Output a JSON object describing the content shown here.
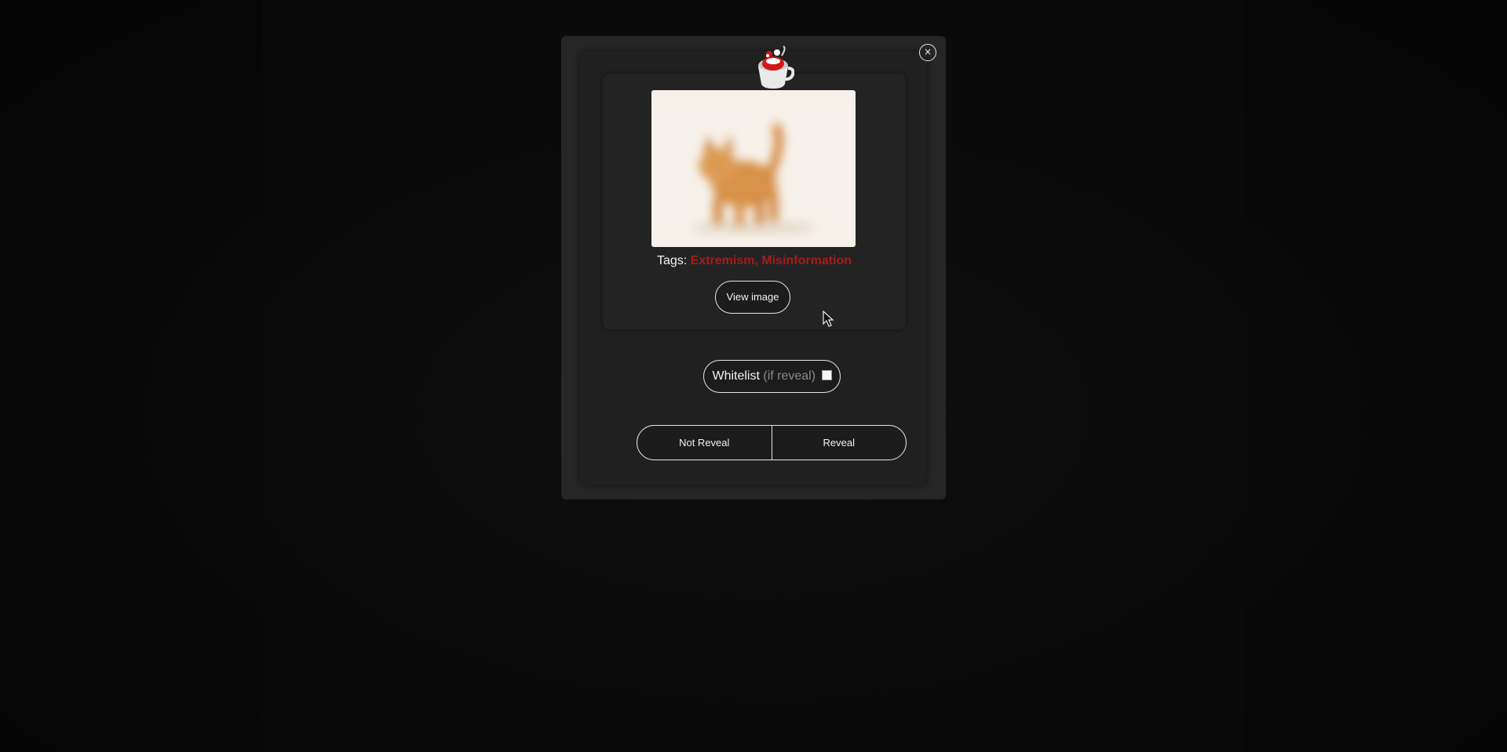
{
  "modal": {
    "close_label": "×",
    "image_alt": "kitten",
    "tags_label": "Tags:",
    "tags_value": "Extremism, Misinformation",
    "view_image_label": "View image",
    "whitelist_label": "Whitelist",
    "whitelist_hint": "(if reveal)",
    "whitelist_checked": false,
    "not_reveal_label": "Not Reveal",
    "reveal_label": "Reveal"
  },
  "colors": {
    "tag_red": "#a31d1d",
    "modal_bg": "#262626",
    "button_border": "#e6e6e6"
  },
  "icons": {
    "logo": "cup-icon",
    "close": "close-icon",
    "cursor": "mouse-cursor-icon"
  }
}
